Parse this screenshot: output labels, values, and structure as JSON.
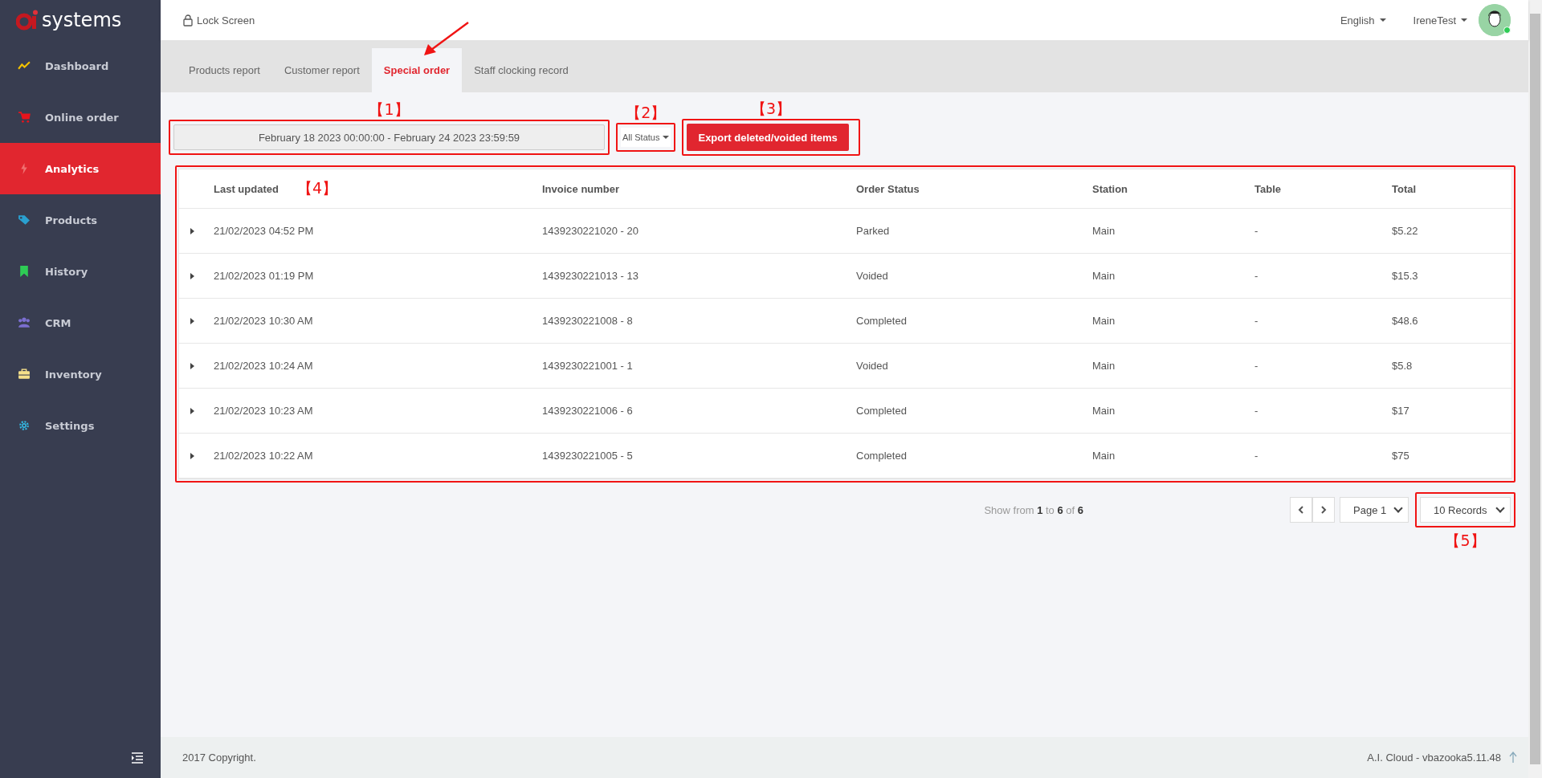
{
  "sidebar": {
    "brand": "systems",
    "items": [
      {
        "label": "Dashboard",
        "kind": "chart",
        "selected": false
      },
      {
        "label": "Online order",
        "kind": "cart",
        "selected": false
      },
      {
        "label": "Analytics",
        "kind": "bolt",
        "selected": true
      },
      {
        "label": "Products",
        "kind": "tag",
        "selected": false
      },
      {
        "label": "History",
        "kind": "bookmark",
        "selected": false
      },
      {
        "label": "CRM",
        "kind": "users",
        "selected": false
      },
      {
        "label": "Inventory",
        "kind": "briefcase",
        "selected": false
      },
      {
        "label": "Settings",
        "kind": "gear",
        "selected": false
      }
    ]
  },
  "topbar": {
    "lock_screen": "Lock Screen",
    "language": "English",
    "user": {
      "name": "IreneTest",
      "online": true
    }
  },
  "tabs": [
    {
      "label": "Products report",
      "selected": false,
      "pointed": false
    },
    {
      "label": "Customer report",
      "selected": false,
      "pointed": false
    },
    {
      "label": "Special order",
      "selected": true,
      "pointed": true
    },
    {
      "label": "Staff clocking record",
      "selected": false,
      "pointed": false
    }
  ],
  "filters": {
    "date_range": {
      "value": "February 18 2023 00:00:00 - February 24 2023 23:59:59",
      "callout": "【1】"
    },
    "status": {
      "value": "All Status",
      "callout": "【2】"
    },
    "export_button": {
      "label": "Export deleted/voided items",
      "callout": "【3】"
    }
  },
  "table": {
    "callout": "【4】",
    "columns": [
      "Last updated",
      "Invoice number",
      "Order Status",
      "Station",
      "Table",
      "Total"
    ],
    "rows": [
      {
        "expanded": false,
        "cells": [
          "21/02/2023 04:52 PM",
          "1439230221020 - 20",
          "Parked",
          "Main",
          "-",
          "$5.22"
        ]
      },
      {
        "expanded": false,
        "cells": [
          "21/02/2023 01:19 PM",
          "1439230221013 - 13",
          "Voided",
          "Main",
          "-",
          "$15.3"
        ]
      },
      {
        "expanded": false,
        "cells": [
          "21/02/2023 10:30 AM",
          "1439230221008 - 8",
          "Completed",
          "Main",
          "-",
          "$48.6"
        ]
      },
      {
        "expanded": false,
        "cells": [
          "21/02/2023 10:24 AM",
          "1439230221001 - 1",
          "Voided",
          "Main",
          "-",
          "$5.8"
        ]
      },
      {
        "expanded": false,
        "cells": [
          "21/02/2023 10:23 AM",
          "1439230221006 - 6",
          "Completed",
          "Main",
          "-",
          "$17"
        ]
      },
      {
        "expanded": false,
        "cells": [
          "21/02/2023 10:22 AM",
          "1439230221005 - 5",
          "Completed",
          "Main",
          "-",
          "$75"
        ]
      }
    ]
  },
  "pagination": {
    "summary": "Show from **1** to **6** of **6**",
    "page": "Page 1",
    "records": {
      "value": "10 Records",
      "callout": "【5】"
    }
  },
  "footer": {
    "copyright": "2017 Copyright.",
    "version": "A.I. Cloud - vbazooka5.11.48"
  }
}
